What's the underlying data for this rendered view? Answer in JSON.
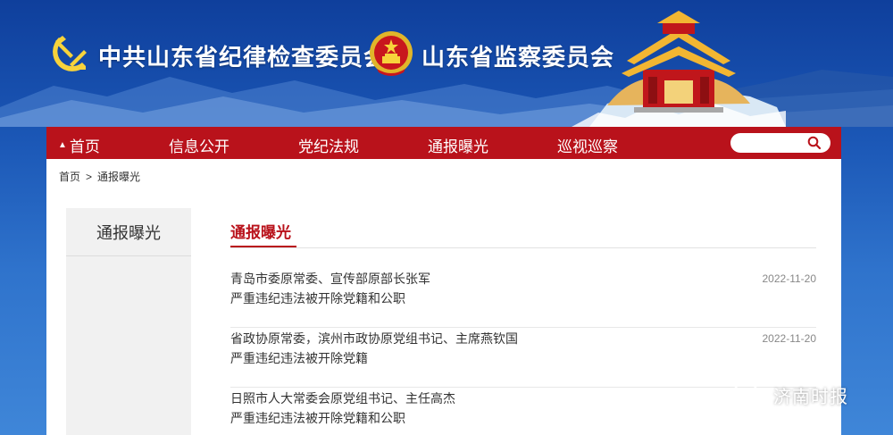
{
  "header": {
    "title_1": "中共山东省纪律检查委员会",
    "title_2": "山东省监察委员会"
  },
  "nav": {
    "items": [
      {
        "label": "首页",
        "icon": "house-icon"
      },
      {
        "label": "信息公开"
      },
      {
        "label": "党纪法规"
      },
      {
        "label": "通报曝光"
      },
      {
        "label": "巡视巡察"
      }
    ],
    "search": {
      "placeholder": "",
      "icon": "search-icon"
    }
  },
  "breadcrumb": {
    "home": "首页",
    "separator": ">",
    "current": "通报曝光"
  },
  "sidebar": {
    "title": "通报曝光"
  },
  "section": {
    "title": "通报曝光",
    "articles": [
      {
        "line1": "青岛市委原常委、宣传部原部长张军",
        "line2": "严重违纪违法被开除党籍和公职",
        "date": "2022-11-20"
      },
      {
        "line1": "省政协原常委，滨州市政协原党组书记、主席燕钦国",
        "line2": "严重违纪违法被开除党籍",
        "date": "2022-11-20"
      },
      {
        "line1": "日照市人大常委会原党组书记、主任高杰",
        "line2": "严重违纪违法被开除党籍和公职",
        "date": ""
      }
    ]
  },
  "watermark": {
    "text": "济南时报"
  },
  "colors": {
    "nav_red": "#b9121b",
    "background_blue": "#1b57b6",
    "accent_red": "#b9121b"
  }
}
